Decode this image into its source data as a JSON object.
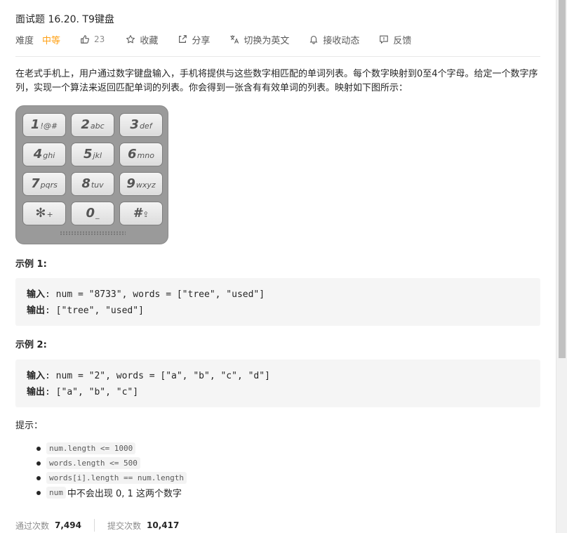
{
  "title": "面试题 16.20. T9键盘",
  "meta": {
    "difficulty_label": "难度",
    "difficulty": "中等",
    "likes": "23",
    "favorite": "收藏",
    "share": "分享",
    "switch_lang": "切换为英文",
    "notify": "接收动态",
    "feedback": "反馈"
  },
  "description": "在老式手机上，用户通过数字键盘输入，手机将提供与这些数字相匹配的单词列表。每个数字映射到0至4个字母。给定一个数字序列，实现一个算法来返回匹配单词的列表。你会得到一张含有有效单词的列表。映射如下图所示：",
  "keypad": [
    {
      "digit": "1",
      "letters": "!@#"
    },
    {
      "digit": "2",
      "letters": "abc"
    },
    {
      "digit": "3",
      "letters": "def"
    },
    {
      "digit": "4",
      "letters": "ghi"
    },
    {
      "digit": "5",
      "letters": "jkl"
    },
    {
      "digit": "6",
      "letters": "mno"
    },
    {
      "digit": "7",
      "letters": "pqrs"
    },
    {
      "digit": "8",
      "letters": "tuv"
    },
    {
      "digit": "9",
      "letters": "wxyz"
    },
    {
      "digit": "✻",
      "letters": "+"
    },
    {
      "digit": "0",
      "letters": "_"
    },
    {
      "digit": "#",
      "letters": "⇪"
    }
  ],
  "examples": [
    {
      "title": "示例 1:",
      "input_label": "输入",
      "input": ": num = \"8733\", words = [\"tree\", \"used\"]",
      "output_label": "输出",
      "output": ": [\"tree\", \"used\"]"
    },
    {
      "title": "示例 2:",
      "input_label": "输入",
      "input": ": num = \"2\", words = [\"a\", \"b\", \"c\", \"d\"]",
      "output_label": "输出",
      "output": ": [\"a\", \"b\", \"c\"]"
    }
  ],
  "hints_title": "提示：",
  "hints": [
    {
      "code": "num.length <= 1000",
      "text": ""
    },
    {
      "code": "words.length <= 500",
      "text": ""
    },
    {
      "code": "words[i].length == num.length",
      "text": ""
    },
    {
      "code": "num",
      "text": "中不会出现 0, 1 这两个数字"
    }
  ],
  "stats": {
    "accepted_label": "通过次数",
    "accepted": "7,494",
    "submissions_label": "提交次数",
    "submissions": "10,417"
  },
  "colors": {
    "difficulty_medium": "#ffa116",
    "code_bg": "#f5f5f5"
  }
}
